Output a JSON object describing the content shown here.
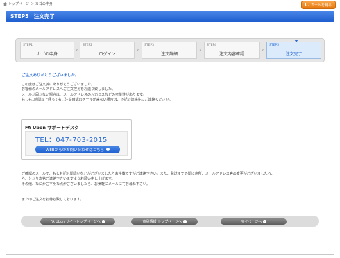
{
  "breadcrumb": {
    "home": "トップページ",
    "sep": "＞",
    "current": "カゴの中身"
  },
  "cart_button": {
    "label": "カートを見る",
    "icon": "cart-icon"
  },
  "header": {
    "title": "STEP5　注文完了"
  },
  "steps": [
    {
      "num": "STEP1",
      "label": "カゴの中身"
    },
    {
      "num": "STEP2",
      "label": "ログイン"
    },
    {
      "num": "STEP3",
      "label": "注文詳細"
    },
    {
      "num": "STEP4",
      "label": "注文内容確認"
    },
    {
      "num": "STEP5",
      "label": "注文完了"
    }
  ],
  "thanks": "ご注文ありがとうございました。",
  "para1": [
    "この度はご注文誠にありがとうございました。",
    "お客様のメールアドレスへご注文控えをお送り致しました。",
    "メールが届かない場合は、メールアドレスの入力ミスなどの可能性があります。",
    "もしも1時間以上経ってもご注文確認のメールが来ない場合は、下記の連絡先にご連絡ください。"
  ],
  "support": {
    "title": "FA Ubon サポートデスク",
    "tel": "TEL：047-703-2015",
    "web_button": "WEBからのお問い合わせはこちら"
  },
  "para2": [
    "ご確認のメールで、もしも記入間違いなどがございましたらお手数ですがご連絡下さい。また、発送までの間に住所、メールアドレス等の変更がございましたら、",
    "ら、分かり次第ご連絡下さいますようお願い申し上げます。",
    "その他、なにかご不明な点がございましたら、お気軽にメールにてお尋ね下さい。"
  ],
  "closing": "またのご注文をお待ち致しております。",
  "footer_buttons": [
    {
      "label": "FA Ubon サイトトップページへ"
    },
    {
      "label": "商品情報 トップページへ"
    },
    {
      "label": "マイページへ"
    }
  ],
  "colors": {
    "accent": "#2a6bd1",
    "header": "#1f5fcf",
    "cart": "#e6780c"
  }
}
